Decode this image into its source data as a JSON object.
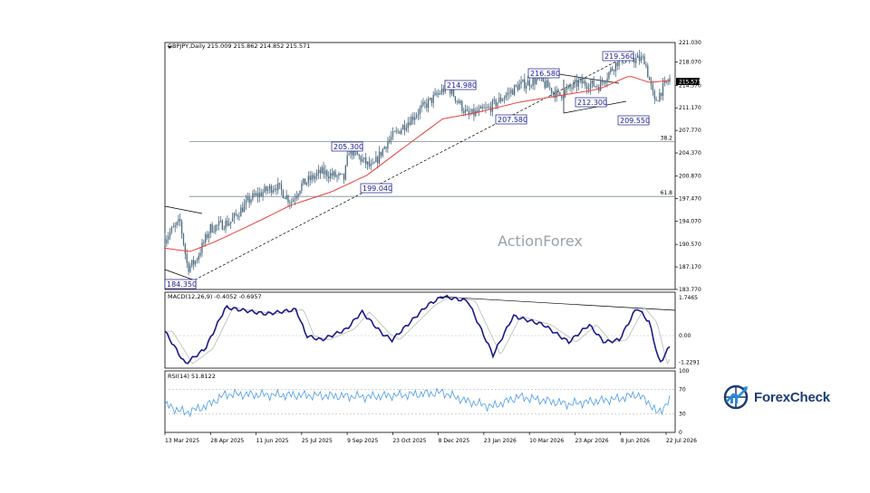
{
  "header": {
    "symbol_line": "GBPJPY,Daily  215.009 215.862 214.852 215.571",
    "top_value": "221.030",
    "current_price": "215.571"
  },
  "watermark": "ActionForex",
  "colors": {
    "candles": "#4d6b80",
    "ma": "#e8413a",
    "macd_main": "#1a1a8c",
    "macd_signal": "#c0c0c0",
    "rsi": "#4a9be8",
    "fib": "#7a8a96",
    "label_text": "#1a1a8c"
  },
  "chart_data": [
    {
      "type": "line",
      "name": "price",
      "ylim": [
        183.77,
        221.03
      ],
      "y_ticks": [
        "221.030",
        "218.070",
        "214.570",
        "211.170",
        "207.770",
        "204.370",
        "200.870",
        "197.470",
        "194.070",
        "190.570",
        "187.170",
        "183.770"
      ],
      "x_ticks": [
        "13 Mar 2025",
        "28 Apr 2025",
        "11 Jun 2025",
        "25 Jul 2025",
        "9 Sep 2025",
        "23 Oct 2025",
        "8 Dec 2025",
        "23 Jan 2026",
        "10 Mar 2026",
        "23 Apr 2026",
        "8 Jun 2026",
        "22 Jul 2026"
      ],
      "close_path": [
        [
          0,
          191.5
        ],
        [
          0.03,
          194
        ],
        [
          0.045,
          187
        ],
        [
          0.06,
          188
        ],
        [
          0.09,
          193
        ],
        [
          0.13,
          194
        ],
        [
          0.17,
          197.5
        ],
        [
          0.22,
          199.5
        ],
        [
          0.25,
          197
        ],
        [
          0.27,
          199.5
        ],
        [
          0.31,
          201.5
        ],
        [
          0.355,
          200.5
        ],
        [
          0.365,
          205
        ],
        [
          0.41,
          202
        ],
        [
          0.44,
          206
        ],
        [
          0.5,
          210.5
        ],
        [
          0.56,
          214.5
        ],
        [
          0.6,
          210
        ],
        [
          0.64,
          211
        ],
        [
          0.7,
          214.5
        ],
        [
          0.74,
          215.5
        ],
        [
          0.78,
          213
        ],
        [
          0.82,
          215
        ],
        [
          0.86,
          214.5
        ],
        [
          0.9,
          218.5
        ],
        [
          0.95,
          218.5
        ],
        [
          0.97,
          212
        ],
        [
          0.985,
          214
        ],
        [
          1.0,
          215.5
        ]
      ],
      "ma_path": [
        [
          0,
          190
        ],
        [
          0.05,
          189.5
        ],
        [
          0.1,
          191
        ],
        [
          0.17,
          193.5
        ],
        [
          0.25,
          196.5
        ],
        [
          0.33,
          198.5
        ],
        [
          0.4,
          201
        ],
        [
          0.47,
          205
        ],
        [
          0.55,
          209.5
        ],
        [
          0.62,
          210.5
        ],
        [
          0.7,
          212
        ],
        [
          0.78,
          213
        ],
        [
          0.86,
          214
        ],
        [
          0.92,
          216
        ],
        [
          0.96,
          215
        ],
        [
          1.0,
          215.3
        ]
      ],
      "labels": [
        "184.350",
        "205.300",
        "199.040",
        "214.980",
        "207.580",
        "216.580",
        "212.300",
        "219.560",
        "209.550"
      ],
      "fib_levels": [
        {
          "label": "38.2",
          "value": 206.1
        },
        {
          "label": "61.8",
          "value": 197.8
        }
      ]
    },
    {
      "type": "line",
      "name": "macd",
      "title": "MACD(12,26,9) -0.4052 -0.6957",
      "y_ticks": [
        "1.7465",
        "0.00",
        "-1.2291"
      ],
      "ylim": [
        -1.5,
        2.0
      ]
    },
    {
      "type": "line",
      "name": "rsi",
      "title": "RSI(14) 51.8122",
      "y_ticks": [
        "100",
        "70",
        "30",
        "0"
      ],
      "ylim": [
        0,
        100
      ]
    }
  ],
  "logo": {
    "name": "ForexCheck",
    "text": "ForexCheck"
  }
}
